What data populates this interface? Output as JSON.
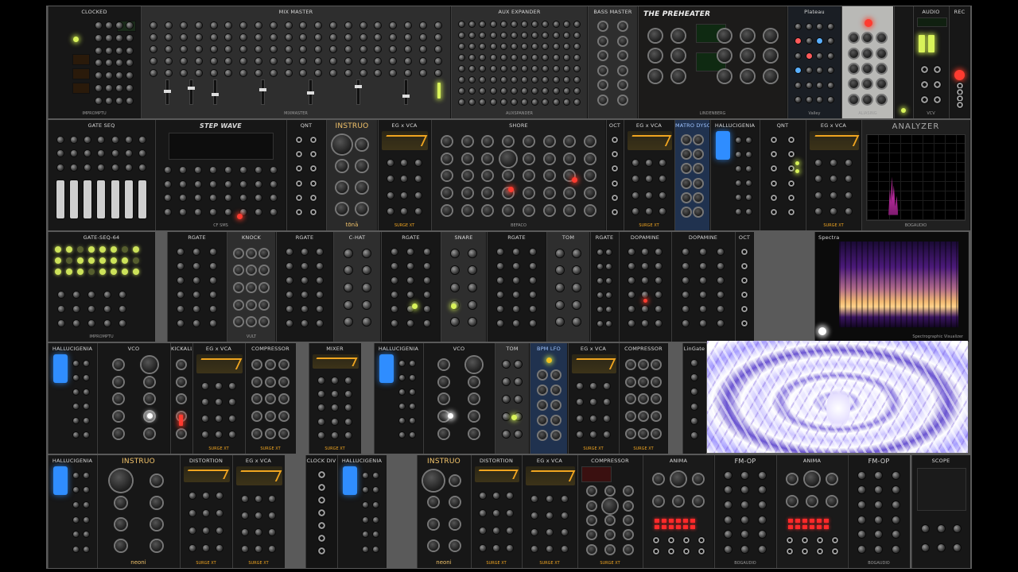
{
  "rows": [
    {
      "modules": [
        {
          "title": "CLOCKED",
          "brand": "IMPROMPTU",
          "style": "dark",
          "kind": "knobs",
          "cols": 3,
          "rows": 7
        },
        {
          "title": "MIX MASTER",
          "brand": "MIXMASTER",
          "style": "mid",
          "kind": "mixer",
          "cols": 12,
          "rows": 7
        },
        {
          "title": "AUX EXPANDER",
          "brand": "AUXSPANDER",
          "style": "mid",
          "kind": "jacks",
          "cols": 12,
          "rows": 8
        },
        {
          "title": "BASS MASTER",
          "brand": "",
          "style": "mid",
          "kind": "knobs",
          "cols": 2,
          "rows": 8
        },
        {
          "title": "THE PREHEATER",
          "brand": "LINDENBERG",
          "style": "dark",
          "kind": "preheater",
          "cols": 3,
          "rows": 3
        },
        {
          "title": "Plateau",
          "brand": "Valley",
          "style": "dark",
          "kind": "plateau",
          "cols": 5,
          "rows": 5
        },
        {
          "title": "",
          "brand": "ALIASING",
          "style": "silver",
          "kind": "knobs",
          "cols": 3,
          "rows": 5
        },
        {
          "title": "",
          "brand": "",
          "style": "dark",
          "kind": "knobs",
          "cols": 1,
          "rows": 4
        },
        {
          "title": "AUDIO",
          "brand": "VCV",
          "style": "dark",
          "kind": "audio",
          "cols": 2,
          "rows": 3
        },
        {
          "title": "REC",
          "brand": "",
          "style": "dark",
          "kind": "knobs",
          "cols": 1,
          "rows": 4
        }
      ]
    },
    {
      "modules": [
        {
          "title": "GATE SEQ",
          "brand": "",
          "style": "dark",
          "kind": "sliders",
          "cols": 7,
          "rows": 3
        },
        {
          "title": "STEP WAVE",
          "brand": "CF SMS",
          "style": "dark",
          "kind": "stepwave",
          "cols": 8,
          "rows": 4
        },
        {
          "title": "QNT",
          "brand": "",
          "style": "dark",
          "kind": "jacks",
          "cols": 2,
          "rows": 6
        },
        {
          "title": "INSTRUO",
          "brand": "tōnā",
          "style": "sand",
          "kind": "tona",
          "cols": 2,
          "rows": 5
        },
        {
          "title": "EG x VCA",
          "brand": "SURGE XT",
          "style": "dark",
          "kind": "eg",
          "cols": 3,
          "rows": 4
        },
        {
          "title": "SHORE",
          "brand": "BEFACO",
          "style": "dark",
          "kind": "knobs",
          "cols": 8,
          "rows": 5
        },
        {
          "title": "OCT",
          "brand": "",
          "style": "dark",
          "kind": "jacks",
          "cols": 1,
          "rows": 6
        },
        {
          "title": "EG x VCA",
          "brand": "SURGE XT",
          "style": "dark",
          "kind": "eg",
          "cols": 3,
          "rows": 4
        },
        {
          "title": "MATRO DYSON",
          "brand": "",
          "style": "blue",
          "kind": "knobs",
          "cols": 2,
          "rows": 6
        },
        {
          "title": "HALLUCIGENIA",
          "brand": "",
          "style": "dark",
          "kind": "halluc",
          "cols": 3,
          "rows": 6
        },
        {
          "title": "QNT",
          "brand": "",
          "style": "dark",
          "kind": "jacks",
          "cols": 2,
          "rows": 6
        },
        {
          "title": "EG x VCA",
          "brand": "SURGE XT",
          "style": "dark",
          "kind": "eg",
          "cols": 3,
          "rows": 4
        },
        {
          "title": "ANALYZER",
          "brand": "BOGAUDIO",
          "style": "dark",
          "kind": "analyzer",
          "cols": 4,
          "rows": 1
        }
      ]
    },
    {
      "modules": [
        {
          "title": "GATE-SEQ-64",
          "brand": "IMPROMPTU",
          "style": "dark",
          "kind": "gateseq",
          "cols": 8,
          "rows": 4
        },
        {
          "title": "RGATE",
          "brand": "",
          "style": "dark",
          "kind": "knobs",
          "cols": 3,
          "rows": 6
        },
        {
          "title": "KNOCK",
          "brand": "VULT",
          "style": "mid",
          "kind": "knobs",
          "cols": 3,
          "rows": 5
        },
        {
          "title": "RGATE",
          "brand": "",
          "style": "dark",
          "kind": "knobs",
          "cols": 3,
          "rows": 6
        },
        {
          "title": "C-HAT",
          "brand": "",
          "style": "mid",
          "kind": "knobs",
          "cols": 2,
          "rows": 5
        },
        {
          "title": "RGATE",
          "brand": "",
          "style": "dark",
          "kind": "knobs",
          "cols": 3,
          "rows": 6
        },
        {
          "title": "SNARE",
          "brand": "",
          "style": "mid",
          "kind": "knobs",
          "cols": 2,
          "rows": 5
        },
        {
          "title": "RGATE",
          "brand": "",
          "style": "dark",
          "kind": "knobs",
          "cols": 3,
          "rows": 6
        },
        {
          "title": "TOM",
          "brand": "",
          "style": "mid",
          "kind": "knobs",
          "cols": 2,
          "rows": 5
        },
        {
          "title": "RGATE",
          "brand": "",
          "style": "dark",
          "kind": "knobs",
          "cols": 2,
          "rows": 6
        },
        {
          "title": "DOPAMINE",
          "brand": "",
          "style": "dark",
          "kind": "knobs",
          "cols": 3,
          "rows": 6
        },
        {
          "title": "DOPAMINE",
          "brand": "",
          "style": "dark",
          "kind": "knobs",
          "cols": 3,
          "rows": 6
        },
        {
          "title": "OCT",
          "brand": "",
          "style": "dark",
          "kind": "jacks",
          "cols": 1,
          "rows": 6
        },
        {
          "title": "Spectra",
          "brand": "Spectrographic Visualizer",
          "style": "dark",
          "kind": "spectra",
          "cols": 1,
          "rows": 1
        }
      ]
    },
    {
      "modules": [
        {
          "title": "HALLUCIGENIA",
          "brand": "",
          "style": "dark",
          "kind": "halluc",
          "cols": 3,
          "rows": 6
        },
        {
          "title": "VCO",
          "brand": "",
          "style": "dark",
          "kind": "knobs",
          "cols": 2,
          "rows": 5
        },
        {
          "title": "KICKALL",
          "brand": "",
          "style": "dark",
          "kind": "knobs",
          "cols": 1,
          "rows": 5
        },
        {
          "title": "EG x VCA",
          "brand": "SURGE XT",
          "style": "dark",
          "kind": "eg",
          "cols": 3,
          "rows": 4
        },
        {
          "title": "COMPRESSOR",
          "brand": "SURGE XT",
          "style": "dark",
          "kind": "knobs",
          "cols": 3,
          "rows": 5
        },
        {
          "title": "MIXER",
          "brand": "SURGE XT",
          "style": "dark",
          "kind": "mixer2",
          "cols": 3,
          "rows": 5
        },
        {
          "title": "HALLUCIGENIA",
          "brand": "",
          "style": "dark",
          "kind": "halluc",
          "cols": 3,
          "rows": 6
        },
        {
          "title": "VCO",
          "brand": "",
          "style": "dark",
          "kind": "knobs",
          "cols": 2,
          "rows": 5
        },
        {
          "title": "TOM",
          "brand": "",
          "style": "mid",
          "kind": "knobs",
          "cols": 2,
          "rows": 5
        },
        {
          "title": "BPM LFO",
          "brand": "",
          "style": "blue",
          "kind": "knobs",
          "cols": 2,
          "rows": 5
        },
        {
          "title": "EG x VCA",
          "brand": "SURGE XT",
          "style": "dark",
          "kind": "eg",
          "cols": 3,
          "rows": 4
        },
        {
          "title": "COMPRESSOR",
          "brand": "SURGE XT",
          "style": "dark",
          "kind": "knobs",
          "cols": 3,
          "rows": 5
        },
        {
          "title": "LinGate",
          "brand": "",
          "style": "dark",
          "kind": "knobs",
          "cols": 1,
          "rows": 6
        }
      ]
    },
    {
      "modules": [
        {
          "title": "HALLUCIGENIA",
          "brand": "",
          "style": "dark",
          "kind": "halluc",
          "cols": 3,
          "rows": 6
        },
        {
          "title": "INSTRUO",
          "brand": "neoni",
          "style": "dark",
          "kind": "tona",
          "cols": 2,
          "rows": 5
        },
        {
          "title": "DISTORTION",
          "brand": "SURGE XT",
          "style": "dark",
          "kind": "eg",
          "cols": 3,
          "rows": 4
        },
        {
          "title": "EG x VCA",
          "brand": "SURGE XT",
          "style": "dark",
          "kind": "eg",
          "cols": 3,
          "rows": 4
        },
        {
          "title": "CLOCK DIV",
          "brand": "",
          "style": "dark",
          "kind": "jacks",
          "cols": 1,
          "rows": 7
        },
        {
          "title": "HALLUCIGENIA",
          "brand": "",
          "style": "dark",
          "kind": "halluc",
          "cols": 3,
          "rows": 6
        },
        {
          "title": "INSTRUO",
          "brand": "neoni",
          "style": "dark",
          "kind": "tona",
          "cols": 2,
          "rows": 5
        },
        {
          "title": "DISTORTION",
          "brand": "SURGE XT",
          "style": "dark",
          "kind": "eg",
          "cols": 3,
          "rows": 4
        },
        {
          "title": "EG x VCA",
          "brand": "SURGE XT",
          "style": "dark",
          "kind": "eg",
          "cols": 3,
          "rows": 4
        },
        {
          "title": "COMPRESSOR",
          "brand": "SURGE XT",
          "style": "dark",
          "kind": "knobs",
          "cols": 3,
          "rows": 5
        },
        {
          "title": "ANIMA",
          "brand": "",
          "style": "dark",
          "kind": "anima",
          "cols": 3,
          "rows": 3
        },
        {
          "title": "FM-OP",
          "brand": "BOGAUDIO",
          "style": "dark",
          "kind": "knobs",
          "cols": 3,
          "rows": 6
        },
        {
          "title": "ANIMA",
          "brand": "",
          "style": "dark",
          "kind": "anima",
          "cols": 3,
          "rows": 3
        },
        {
          "title": "FM-OP",
          "brand": "BOGAUDIO",
          "style": "dark",
          "kind": "knobs",
          "cols": 3,
          "rows": 6
        },
        {
          "title": "SCOPE",
          "brand": "",
          "style": "dark",
          "kind": "scope",
          "cols": 3,
          "rows": 2
        }
      ]
    }
  ]
}
